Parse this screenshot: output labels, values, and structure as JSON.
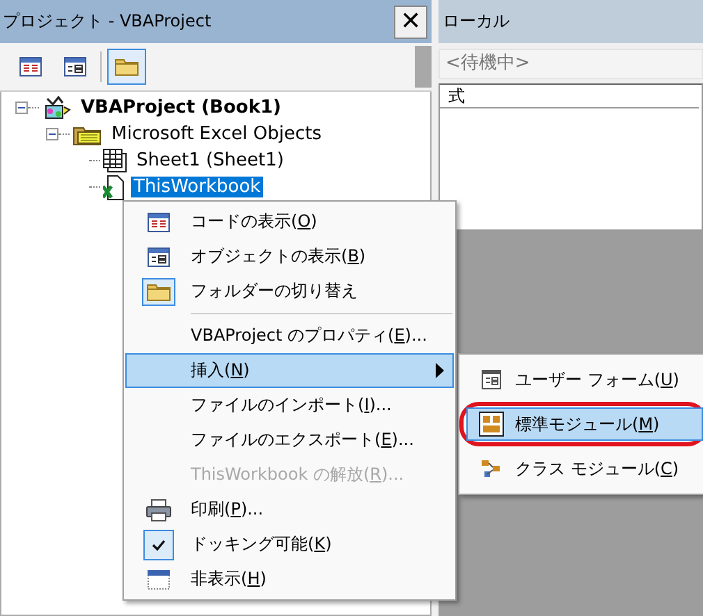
{
  "project_pane": {
    "title": "プロジェクト - VBAProject",
    "close": "✕",
    "toolbar": [
      {
        "selected": false
      },
      {
        "selected": false
      },
      {
        "selected": true
      }
    ],
    "tree": [
      {
        "label": "VBAProject (Book1)",
        "expanded": true,
        "selected": false,
        "children": [
          {
            "label": "Microsoft Excel Objects",
            "expanded": true,
            "selected": false,
            "children": [
              {
                "label": "Sheet1 (Sheet1)",
                "selected": false
              },
              {
                "label": "ThisWorkbook",
                "selected": true
              }
            ]
          }
        ]
      }
    ]
  },
  "locals_pane": {
    "title": "ローカル",
    "status": "<待機中>",
    "columns": [
      "式"
    ]
  },
  "context_menu": {
    "items": [
      {
        "kind": "item",
        "label": "コードの表示(",
        "accel": "O",
        "tail": ")",
        "selected": false,
        "disabled": false
      },
      {
        "kind": "item",
        "label": "オブジェクトの表示(",
        "accel": "B",
        "tail": ")",
        "selected": false,
        "disabled": false
      },
      {
        "kind": "item",
        "label": "フォルダーの切り替え",
        "selected": false,
        "disabled": false
      },
      {
        "kind": "separator"
      },
      {
        "kind": "item",
        "label": "VBAProject のプロパティ(",
        "accel": "E",
        "tail": ")...",
        "selected": false,
        "disabled": false
      },
      {
        "kind": "item",
        "label": "挿入(",
        "accel": "N",
        "tail": ")",
        "selected": true,
        "disabled": false,
        "submenu": [
          {
            "label": "ユーザー フォーム(",
            "accel": "U",
            "tail": ")",
            "selected": false,
            "highlighted": false
          },
          {
            "label": "標準モジュール(",
            "accel": "M",
            "tail": ")",
            "selected": true,
            "highlighted": true
          },
          {
            "label": "クラス モジュール(",
            "accel": "C",
            "tail": ")",
            "selected": false,
            "highlighted": false
          }
        ]
      },
      {
        "kind": "item",
        "label": "ファイルのインポート(",
        "accel": "I",
        "tail": ")...",
        "selected": false,
        "disabled": false
      },
      {
        "kind": "item",
        "label": "ファイルのエクスポート(",
        "accel": "E",
        "tail": ")...",
        "selected": false,
        "disabled": false
      },
      {
        "kind": "item",
        "label": "ThisWorkbook の解放(",
        "accel": "R",
        "tail": ")...",
        "selected": false,
        "disabled": true
      },
      {
        "kind": "item",
        "label": "印刷(",
        "accel": "P",
        "tail": ")...",
        "selected": false,
        "disabled": false
      },
      {
        "kind": "item",
        "label": "ドッキング可能(",
        "accel": "K",
        "tail": ")",
        "selected": false,
        "disabled": false,
        "checked": true
      },
      {
        "kind": "item",
        "label": "非表示(",
        "accel": "H",
        "tail": ")",
        "selected": false,
        "disabled": false
      }
    ]
  }
}
